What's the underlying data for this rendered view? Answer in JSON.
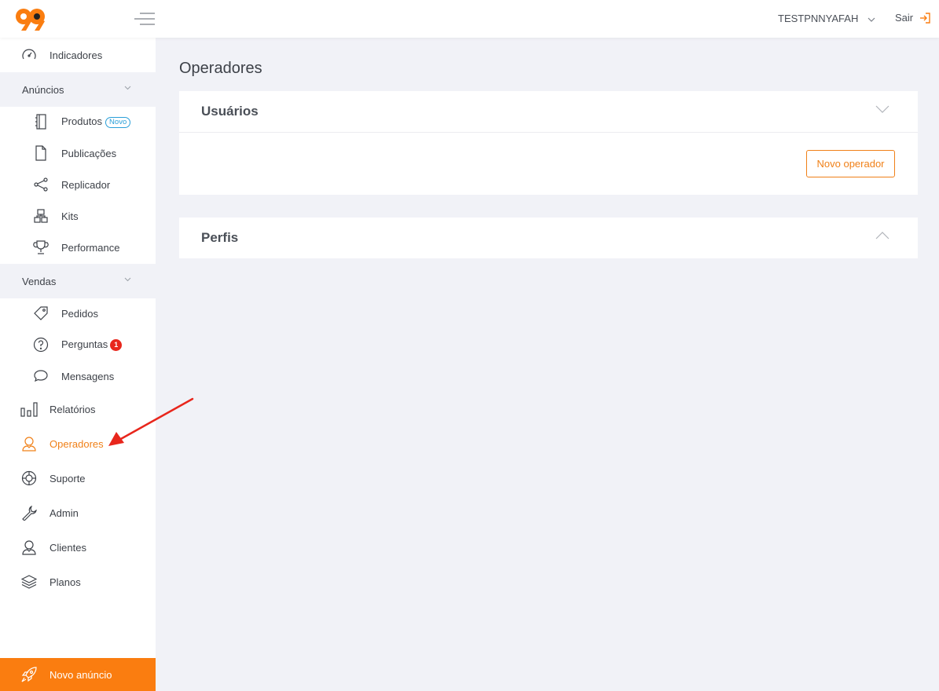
{
  "header": {
    "user_label": "TESTPNNYAFAH",
    "logout_label": "Sair"
  },
  "sidebar": {
    "indicadores": "Indicadores",
    "anuncios_section": "Anúncios",
    "produtos": "Produtos",
    "produtos_badge": "Novo",
    "publicacoes": "Publicações",
    "replicador": "Replicador",
    "kits": "Kits",
    "performance": "Performance",
    "vendas_section": "Vendas",
    "pedidos": "Pedidos",
    "perguntas": "Perguntas",
    "perguntas_count": "1",
    "mensagens": "Mensagens",
    "relatorios": "Relatórios",
    "operadores": "Operadores",
    "suporte": "Suporte",
    "admin": "Admin",
    "clientes": "Clientes",
    "planos": "Planos",
    "new_ad": "Novo anúncio"
  },
  "main": {
    "page_title": "Operadores",
    "usuarios_title": "Usuários",
    "new_operator_button": "Novo operador",
    "perfis_title": "Perfis"
  },
  "colors": {
    "accent": "#fa7d10",
    "badge_blue": "#2a9fd8",
    "badge_red": "#e8261c",
    "annotation_arrow": "#e8261c"
  },
  "icons": {
    "logo": "99-logo",
    "menu": "hamburger-icon",
    "indicadores": "speedometer-icon",
    "produtos": "notebook-icon",
    "publicacoes": "document-icon",
    "replicador": "share-icon",
    "kits": "blocks-icon",
    "performance": "trophy-icon",
    "pedidos": "tag-icon",
    "perguntas": "question-icon",
    "mensagens": "chat-icon",
    "relatorios": "bar-chart-icon",
    "operadores": "user-icon",
    "suporte": "lifebuoy-icon",
    "admin": "wrench-icon",
    "clientes": "user-icon",
    "planos": "layers-icon",
    "new_ad": "rocket-icon"
  }
}
